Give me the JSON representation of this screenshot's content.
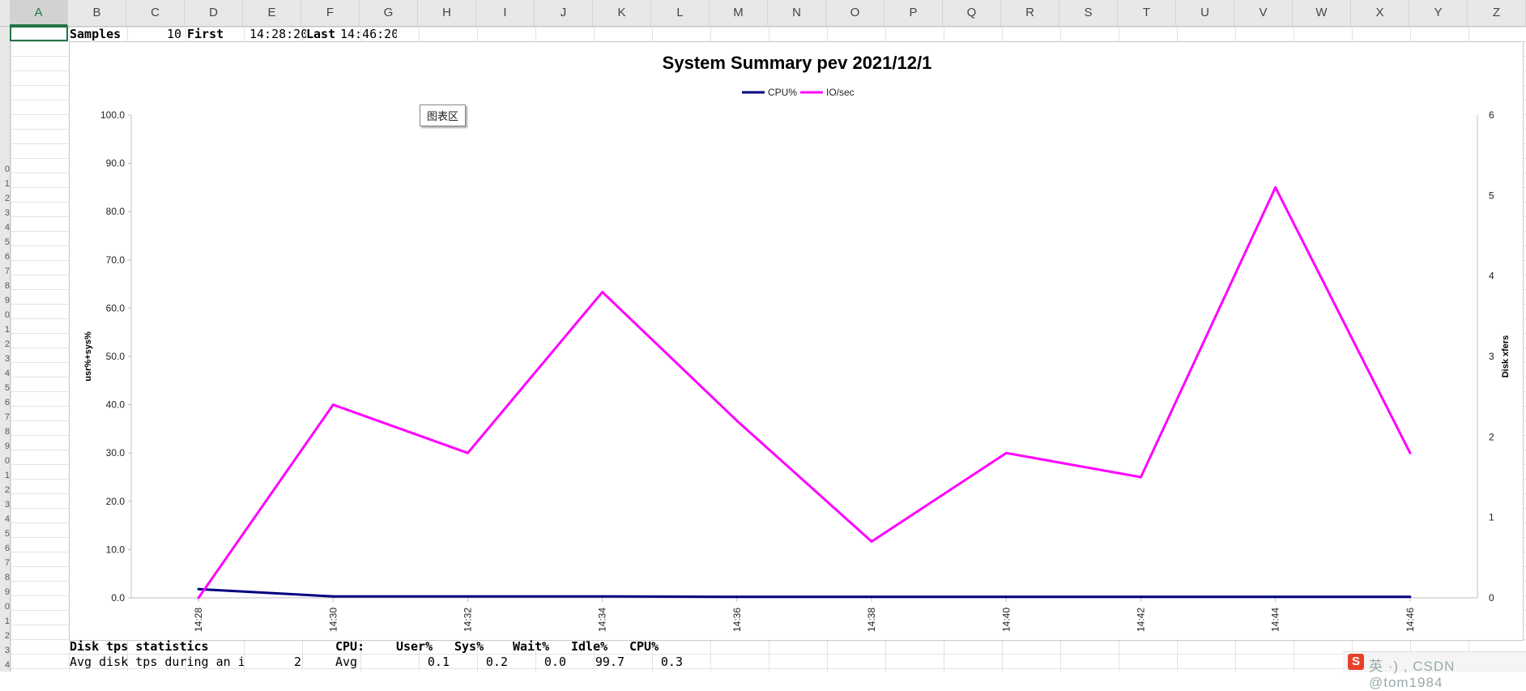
{
  "sheet": {
    "columns": [
      "A",
      "B",
      "C",
      "D",
      "E",
      "F",
      "G",
      "H",
      "I",
      "J",
      "K",
      "L",
      "M",
      "N",
      "O",
      "P",
      "Q",
      "R",
      "S",
      "T",
      "U",
      "V",
      "W",
      "X",
      "Y",
      "Z"
    ],
    "selected_column": "A",
    "row_labels": [
      "0",
      "1",
      "2",
      "3",
      "4",
      "5",
      "6",
      "7",
      "8",
      "9",
      "0",
      "1",
      "2",
      "3",
      "4",
      "5",
      "6",
      "7",
      "8",
      "9",
      "0",
      "1",
      "2",
      "3",
      "4",
      "5",
      "6",
      "7",
      "8",
      "9",
      "0",
      "1",
      "2",
      "3",
      "4"
    ],
    "header_row": {
      "samples_label": "Samples",
      "samples_value": "10",
      "first_label": "First",
      "first_value": "14:28:20",
      "last_label": "Last",
      "last_value": "14:46:20"
    },
    "bottom_rows": {
      "disk_title": "Disk tps statistics",
      "cpu_label": "CPU:",
      "user_h": "User%",
      "sys_h": "Sys%",
      "wait_h": "Wait%",
      "idle_h": "Idle%",
      "cpu_h": "CPU%",
      "avg_disk_label": "Avg disk tps during an inte",
      "avg_disk_value": "2",
      "avg_label": "Avg",
      "user_v": "0.1",
      "sys_v": "0.2",
      "wait_v": "0.0",
      "idle_v": "99.7",
      "cpu_v": "0.3"
    }
  },
  "tooltip": "图表区",
  "ime_watermark": "英 ·)  ,  CSDN @tom1984",
  "ime_logo": "S",
  "chart_data": {
    "type": "line",
    "title": "System Summary pev  2021/12/1",
    "categories": [
      "14:28",
      "14:30",
      "14:32",
      "14:34",
      "14:36",
      "14:38",
      "14:40",
      "14:42",
      "14:44",
      "14:46"
    ],
    "ylabel": "usr%+sys%",
    "y2label": "Disk xfers",
    "ylim": [
      0,
      100
    ],
    "y2lim": [
      0,
      6
    ],
    "yticks": [
      "0.0",
      "10.0",
      "20.0",
      "30.0",
      "40.0",
      "50.0",
      "60.0",
      "70.0",
      "80.0",
      "90.0",
      "100.0"
    ],
    "y2ticks": [
      "0",
      "1",
      "2",
      "3",
      "4",
      "5",
      "6"
    ],
    "legend_position": "top",
    "grid": false,
    "series": [
      {
        "name": "CPU%",
        "axis": "left",
        "color": "#000080",
        "values": [
          1.8,
          0.3,
          0.3,
          0.3,
          0.2,
          0.2,
          0.2,
          0.2,
          0.2,
          0.2
        ]
      },
      {
        "name": "IO/sec",
        "axis": "right",
        "color": "#ff00ff",
        "values": [
          0.0,
          2.4,
          1.8,
          3.8,
          2.2,
          0.7,
          1.8,
          1.5,
          5.1,
          1.8
        ]
      }
    ]
  }
}
